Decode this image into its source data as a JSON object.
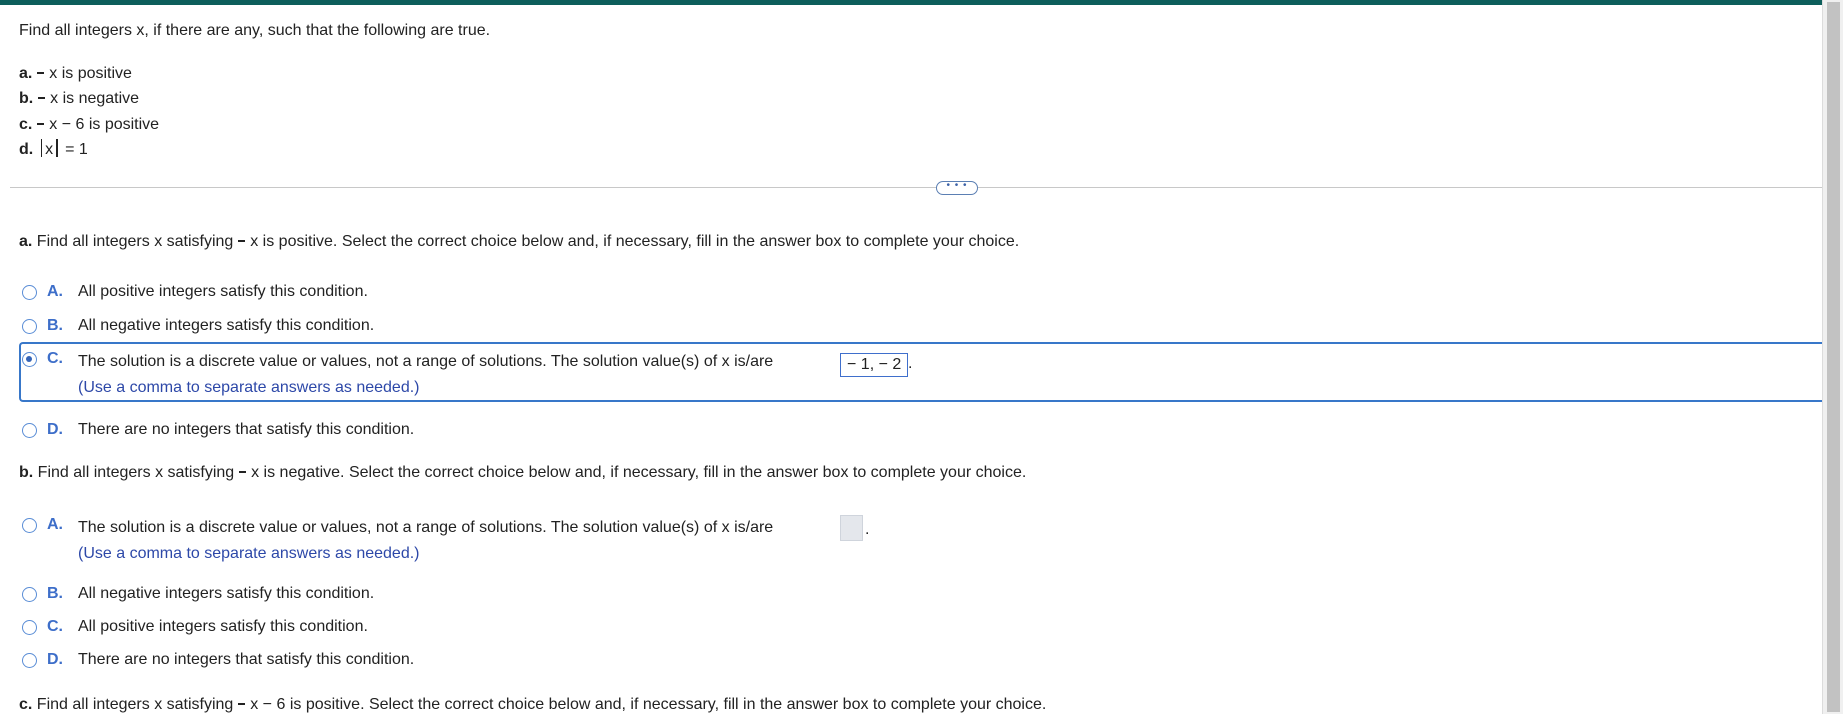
{
  "problem": {
    "statement": "Find all integers x, if there are any, such that the following are true.",
    "items": [
      {
        "letter": "a.",
        "text": "x is positive"
      },
      {
        "letter": "b.",
        "text": "x is negative"
      },
      {
        "letter": "c.",
        "text": "x − 6 is positive"
      },
      {
        "letter": "d.",
        "text_left": "x",
        "text_right": "= 1"
      }
    ]
  },
  "expander": {
    "label": "• • •"
  },
  "part_a": {
    "prefix": "a.",
    "question_pre": "Find all integers x satisfying",
    "question_post": "x is positive. Select the correct choice below and, if necessary, fill in the answer box to complete your choice.",
    "choices": [
      {
        "letter": "A.",
        "text": "All positive integers satisfy this condition.",
        "selected": false
      },
      {
        "letter": "B.",
        "text": "All negative integers satisfy this condition.",
        "selected": false
      },
      {
        "letter": "C.",
        "text": "The solution is a discrete value or values, not a range of solutions. The solution value(s) of x is/are",
        "answer": "− 1, − 2",
        "suffix": ".",
        "hint": "(Use a comma to separate answers as needed.)",
        "selected": true
      },
      {
        "letter": "D.",
        "text": "There are no integers that satisfy this condition.",
        "selected": false
      }
    ]
  },
  "part_b": {
    "prefix": "b.",
    "question_pre": "Find all integers x satisfying",
    "question_post": "x is negative. Select the correct choice below and, if necessary, fill in the answer box to complete your choice.",
    "choices": [
      {
        "letter": "A.",
        "text": "The solution is a discrete value or values, not a range of solutions. The solution value(s) of x is/are",
        "answer": "",
        "suffix": ".",
        "hint": "(Use a comma to separate answers as needed.)",
        "selected": false
      },
      {
        "letter": "B.",
        "text": "All negative integers satisfy this condition.",
        "selected": false
      },
      {
        "letter": "C.",
        "text": "All positive integers satisfy this condition.",
        "selected": false
      },
      {
        "letter": "D.",
        "text": "There are no integers that satisfy this condition.",
        "selected": false
      }
    ]
  },
  "part_c": {
    "prefix": "c.",
    "question_pre": "Find all integers x satisfying",
    "question_post": "x − 6 is positive. Select the correct choice below and, if necessary, fill in the answer box to complete your choice."
  },
  "colors": {
    "top_bar": "#0d5e5b",
    "choice_letter": "#3d6ec9",
    "hint_text": "#2d48a8",
    "selection_border": "#3877c9"
  }
}
